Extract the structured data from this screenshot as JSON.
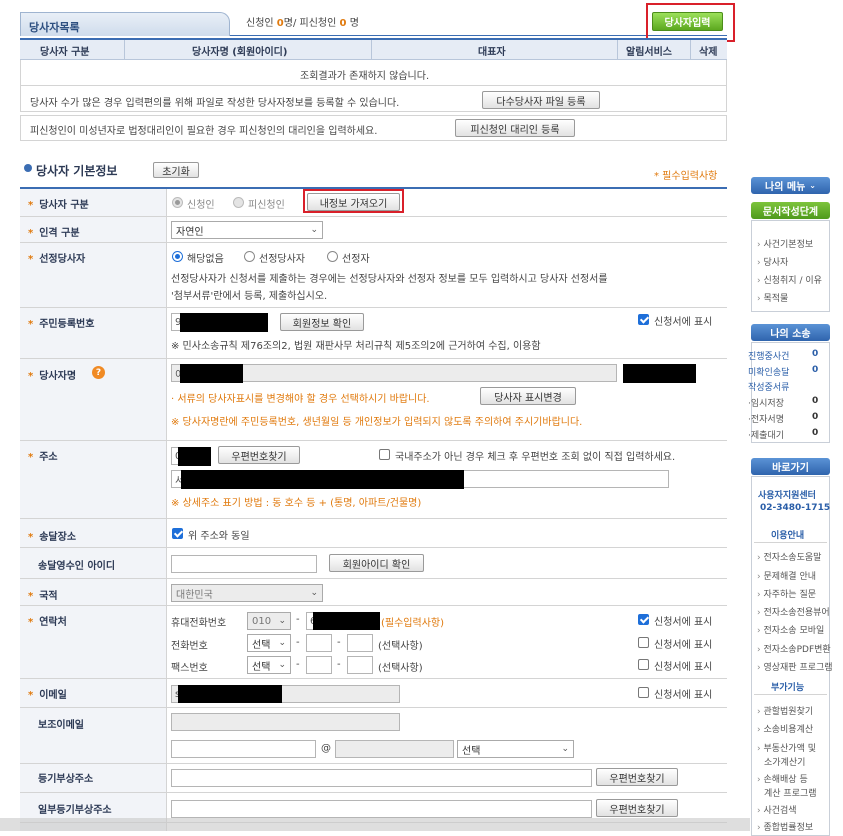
{
  "party_list": {
    "tab_label": "당사자목록",
    "applicant_prefix": "신청인",
    "applicant_count": "0",
    "count_unit": "명",
    "separator": "/",
    "respondent_prefix": "피신청인",
    "respondent_count": "0",
    "add_button": "당사자입력",
    "columns": [
      "당사자 구분",
      "당사자명 (회원아이디)",
      "대표자",
      "알림서비스",
      "삭제"
    ],
    "empty_message": "조회결과가 존재하지 않습니다.",
    "note1": "당사자 수가 많은 경우 입력편의를 위해 파일로 작성한 당사자정보를 등록할 수 있습니다.",
    "note1_button": "다수당사자 파일 등록",
    "note2": "피신청인이 미성년자로 법정대리인이 필요한 경우 피신청인의 대리인을 입력하세요.",
    "note2_button": "피신청인 대리인 등록"
  },
  "basic_info": {
    "title": "당사자 기본정보",
    "reset_button": "초기화",
    "required_note": "* 필수입력사항"
  },
  "form": {
    "party_type": {
      "label": "당사자 구분",
      "options": [
        "신청인",
        "피신청인"
      ],
      "fetch_button": "내정보 가져오기"
    },
    "person_type": {
      "label": "인격 구분",
      "value": "자연인"
    },
    "selected_party": {
      "label": "선정당사자",
      "options": [
        "해당없음",
        "선정당사자",
        "선정자"
      ],
      "desc_line1": "선정당사자가 신청서를 제출하는 경우에는 선정당사자와 선정자 정보를 모두 입력하시고 당사자 선정서를",
      "desc_line2": "'첨부서류'란에서 등록, 제출하십시오."
    },
    "resident_no": {
      "label": "주민등록번호",
      "prefix": "9",
      "check_button": "회원정보 확인",
      "show_label": "신청서에 표시",
      "note": "※ 민사소송규칙 제76조의2, 법원 재판사무 처리규칙 제5조의2에 근거하여 수집, 이용함"
    },
    "party_name": {
      "label": "당사자명",
      "prefix": "이",
      "note1": "· 서류의 당사자표시를 변경해야 할 경우 선택하시기 바랍니다.",
      "change_button": "당사자 표시변경",
      "note2": "※ 당사자명란에 주민등록번호, 생년월일 등 개인정보가 입력되지 않도록 주의하여 주시기바랍니다."
    },
    "address": {
      "label": "주소",
      "zip_prefix": "0",
      "zip_button": "우편번호찾기",
      "foreign_label": "국내주소가 아닌 경우 체크 후 우편번호 조회 없이 직접 입력하세요.",
      "addr_prefix": "서",
      "note": "※ 상세주소 표기 방법 : 동 호수 등 + (통명, 아파트/건물명)"
    },
    "delivery": {
      "label": "송달장소",
      "same_label": "위 주소와 동일"
    },
    "delivery_id": {
      "label": "송달영수인 아이디",
      "check_button": "회원아이디 확인"
    },
    "nationality": {
      "label": "국적",
      "value": "대한민국"
    },
    "contact": {
      "label": "연락처",
      "mobile_label": "휴대전화번호",
      "mobile_prefix": "010",
      "mobile_mid": "6",
      "mobile_required": "(필수입력사항)",
      "phone_label": "전화번호",
      "fax_label": "팩스번호",
      "select_placeholder": "선택",
      "optional": "(선택사항)",
      "dash": "-",
      "show_label": "신청서에 표시"
    },
    "email": {
      "label": "이메일",
      "prefix": "s",
      "show_label": "신청서에 표시"
    },
    "aux_email": {
      "label": "보조이메일",
      "at": "@",
      "domain_select": "선택"
    },
    "reg_address": {
      "label": "등기부상주소",
      "zip_button": "우편번호찾기"
    },
    "partial_reg_address": {
      "label": "일부등기부상주소",
      "zip_button": "우편번호찾기"
    }
  },
  "sidebar": {
    "my_menu": "나의 메뉴",
    "doc_stage": "문서작성단계",
    "stage_items": [
      "사건기본정보",
      "당사자",
      "신청취지 / 이유",
      "목적물"
    ],
    "my_case": "나의 소송",
    "case_items": [
      {
        "label": "진행중사건",
        "count": "0"
      },
      {
        "label": "미확인송달",
        "count": "0"
      },
      {
        "label": "작성중서류",
        "count": ""
      },
      {
        "label": "·임시저장",
        "count": "0"
      },
      {
        "label": "·전자서명",
        "count": "0"
      },
      {
        "label": "·제출대기",
        "count": "0"
      }
    ],
    "shortcut": "바로가기",
    "center_name": "사용자지원센터",
    "center_phone": "02-3480-1715",
    "guide_title": "이용안내",
    "guide_items": [
      "전자소송도움말",
      "문제해결 안내",
      "자주하는 질문",
      "전자소송전용뷰어",
      "전자소송 모바일",
      "전자소송PDF변환",
      "영상재판 프로그램"
    ],
    "extra_title": "부가기능",
    "extra_items": [
      "관할법원찾기",
      "소송비용계산",
      "부동산가액 및",
      "소가계산기",
      "손해배상 등",
      "계산 프로그램",
      "사건검색",
      "종합법률정보"
    ]
  },
  "colors": {
    "accent_blue": "#3b6db3",
    "green": "#6ab52a",
    "orange": "#e07a0e",
    "highlight_red": "#d9202a"
  }
}
